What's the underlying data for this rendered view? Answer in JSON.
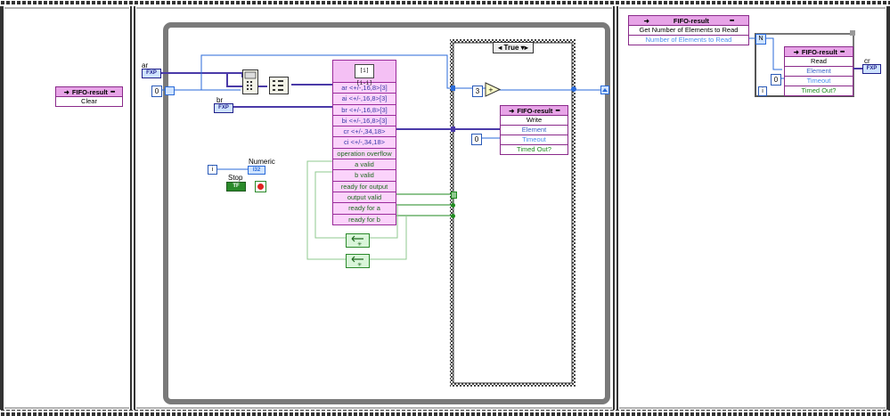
{
  "frame1": {
    "fifo_node": {
      "name": "FIFO-result",
      "method": "Clear"
    }
  },
  "frame2": {
    "inputs": {
      "ar_label": "ar",
      "ar_type": "FXP",
      "br_label": "br",
      "br_type": "FXP",
      "zero_const": "0"
    },
    "ip_node": {
      "ports": [
        "ar <+/-,16,8>[3]",
        "ai <+/-,16,8>[3]",
        "br <+/-,16,8>[3]",
        "bi <+/-,16,8>[3]",
        "cr <+/-,34,18>",
        "ci <+/-,34,18>",
        "operation overflow",
        "a valid",
        "b valid",
        "ready for output",
        "output valid",
        "ready for a",
        "ready for b"
      ]
    },
    "numeric": {
      "label": "Numeric",
      "type": "I32",
      "index": "i"
    },
    "stop": {
      "label": "Stop",
      "const": "TF"
    },
    "case": {
      "selector": "True",
      "const_three": "3",
      "const_zero": "0",
      "op": "+"
    },
    "write_node": {
      "name": "FIFO-result",
      "method": "Write",
      "rows": [
        "Element",
        "Timeout",
        "Timed Out?"
      ]
    }
  },
  "frame3": {
    "get_node": {
      "name": "FIFO-result",
      "method": "Get Number of Elements to Read",
      "output": "Number of Elements to Read"
    },
    "n_terminal": "N",
    "read_node": {
      "name": "FIFO-result",
      "method": "Read",
      "rows": [
        "Element",
        "Timeout",
        "Timed Out?"
      ]
    },
    "timeout_const": "0",
    "iter": "i",
    "out_label": "cr",
    "out_type": "FXP"
  },
  "colors": {
    "fxp_wire": "#4a3aa8",
    "int_wire": "#2a6ad8",
    "bool_wire": "#1f8a1f",
    "fifo_header": "#e7a4e7",
    "node_body": "#fbd3fb"
  }
}
